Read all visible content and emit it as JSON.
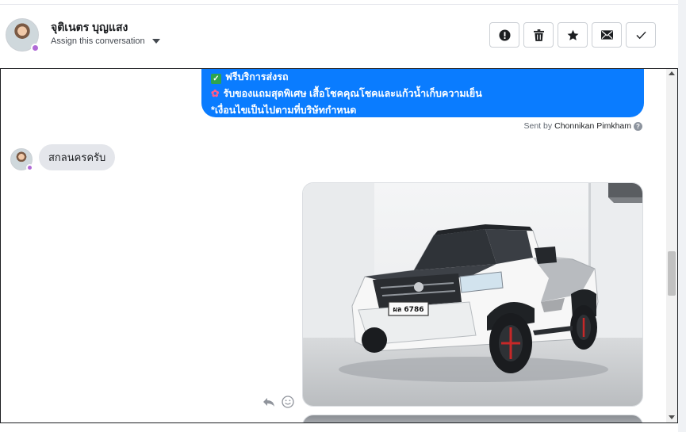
{
  "contact": {
    "name": "จุติเนตร บุญแสง",
    "assign_label": "Assign this conversation"
  },
  "actions": [
    {
      "name": "spam",
      "icon": "exclamation-circle-icon"
    },
    {
      "name": "trash",
      "icon": "trash-icon"
    },
    {
      "name": "star",
      "icon": "star-icon"
    },
    {
      "name": "mark-unread",
      "icon": "envelope-icon"
    },
    {
      "name": "mark-done",
      "icon": "check-icon"
    }
  ],
  "thread": {
    "outgoing_lines": [
      "ฟรีบริการส่งรถ",
      "รับของแถมสุดพิเศษ เสื้อโชคคุณโชคและแก้วน้ำเก็บความเย็น",
      "*เงื่อนไขเป็นไปตามที่บริษัทกำหนด"
    ],
    "sent_by_prefix": "Sent by",
    "sent_by_name": "Chonnikan Pimkham",
    "incoming_text": "สกลนครครับ",
    "photo": {
      "plate_text": "ผล 6786"
    }
  },
  "colors": {
    "outgoing_bubble": "#0a7cff",
    "incoming_bubble": "#e4e6eb",
    "online_badge": "#b06ad6"
  }
}
